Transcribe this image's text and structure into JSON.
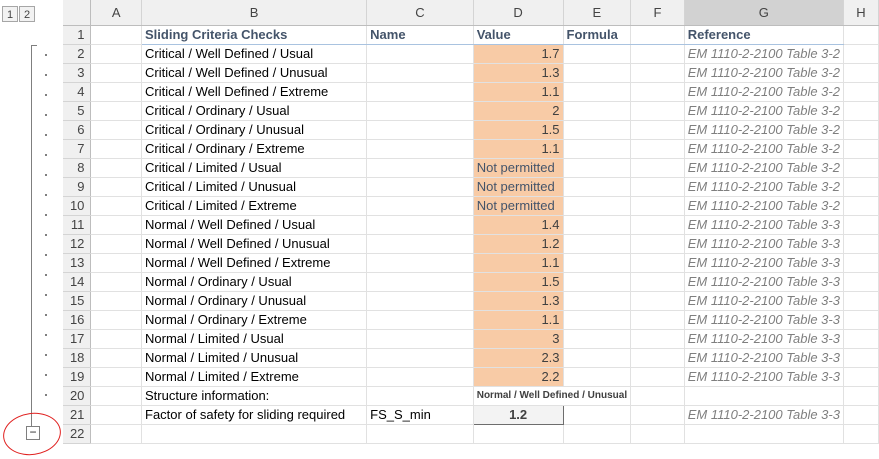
{
  "outline": {
    "level_buttons": [
      "1",
      "2"
    ],
    "collapse_symbol": "−"
  },
  "columns": [
    "A",
    "B",
    "C",
    "D",
    "E",
    "F",
    "G",
    "H"
  ],
  "header_row": {
    "row": "1",
    "b": "Sliding Criteria Checks",
    "c": "Name",
    "d": "Value",
    "e": "Formula",
    "g": "Reference"
  },
  "rows": [
    {
      "row": "2",
      "b": "Critical / Well Defined / Usual",
      "c": "",
      "d": "1.7",
      "g": "EM 1110-2-2100 Table 3-2"
    },
    {
      "row": "3",
      "b": "Critical / Well Defined / Unusual",
      "c": "",
      "d": "1.3",
      "g": "EM 1110-2-2100 Table 3-2"
    },
    {
      "row": "4",
      "b": "Critical / Well Defined / Extreme",
      "c": "",
      "d": "1.1",
      "g": "EM 1110-2-2100 Table 3-2"
    },
    {
      "row": "5",
      "b": "Critical / Ordinary / Usual",
      "c": "",
      "d": "2",
      "g": "EM 1110-2-2100 Table 3-2"
    },
    {
      "row": "6",
      "b": "Critical / Ordinary / Unusual",
      "c": "",
      "d": "1.5",
      "g": "EM 1110-2-2100 Table 3-2"
    },
    {
      "row": "7",
      "b": "Critical / Ordinary / Extreme",
      "c": "",
      "d": "1.1",
      "g": "EM 1110-2-2100 Table 3-2"
    },
    {
      "row": "8",
      "b": "Critical / Limited / Usual",
      "c": "",
      "d": "Not permitted",
      "g": "EM 1110-2-2100 Table 3-2"
    },
    {
      "row": "9",
      "b": "Critical / Limited / Unusual",
      "c": "",
      "d": "Not permitted",
      "g": "EM 1110-2-2100 Table 3-2"
    },
    {
      "row": "10",
      "b": "Critical / Limited / Extreme",
      "c": "",
      "d": "Not permitted",
      "g": "EM 1110-2-2100 Table 3-2"
    },
    {
      "row": "11",
      "b": "Normal / Well Defined / Usual",
      "c": "",
      "d": "1.4",
      "g": "EM 1110-2-2100 Table 3-3"
    },
    {
      "row": "12",
      "b": "Normal / Well Defined / Unusual",
      "c": "",
      "d": "1.2",
      "g": "EM 1110-2-2100 Table 3-3"
    },
    {
      "row": "13",
      "b": "Normal / Well Defined / Extreme",
      "c": "",
      "d": "1.1",
      "g": "EM 1110-2-2100 Table 3-3"
    },
    {
      "row": "14",
      "b": "Normal / Ordinary / Usual",
      "c": "",
      "d": "1.5",
      "g": "EM 1110-2-2100 Table 3-3"
    },
    {
      "row": "15",
      "b": "Normal / Ordinary / Unusual",
      "c": "",
      "d": "1.3",
      "g": "EM 1110-2-2100 Table 3-3"
    },
    {
      "row": "16",
      "b": "Normal / Ordinary / Extreme",
      "c": "",
      "d": "1.1",
      "g": "EM 1110-2-2100 Table 3-3"
    },
    {
      "row": "17",
      "b": "Normal / Limited / Usual",
      "c": "",
      "d": "3",
      "g": "EM 1110-2-2100 Table 3-3"
    },
    {
      "row": "18",
      "b": "Normal / Limited / Unusual",
      "c": "",
      "d": "2.3",
      "g": "EM 1110-2-2100 Table 3-3"
    },
    {
      "row": "19",
      "b": "Normal / Limited / Extreme",
      "c": "",
      "d": "2.2",
      "g": "EM 1110-2-2100 Table 3-3"
    }
  ],
  "row20": {
    "row": "20",
    "b": "Structure information:",
    "d": "Normal / Well Defined / Unusual"
  },
  "row21": {
    "row": "21",
    "b": "Factor of safety for sliding required",
    "c": "FS_S_min",
    "d": "1.2",
    "g": "EM 1110-2-2100 Table 3-3"
  },
  "row22": {
    "row": "22"
  },
  "colors": {
    "value_fill": "#f8cba6",
    "header_text": "#44546a",
    "annotation_circle": "#e0201f"
  }
}
